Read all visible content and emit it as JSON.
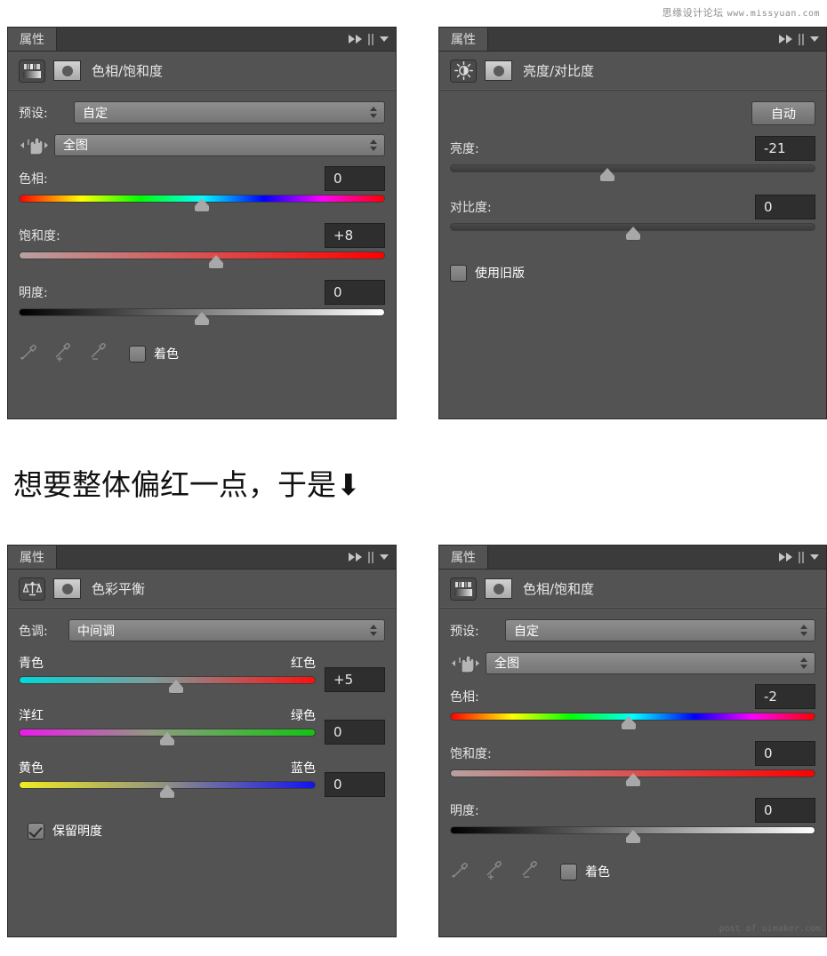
{
  "watermarks": {
    "top_cn": "思缘设计论坛",
    "top_url": "www.missyuan.com",
    "bottom": "post of uimaker.com"
  },
  "caption": "想要整体偏红一点，于是⬇",
  "common": {
    "tab_label": "属性",
    "collapse_icon": "double-right-arrow-icon",
    "grip_icon": "panel-grip-icon",
    "menu_icon": "panel-menu-chevron-icon"
  },
  "panels": [
    {
      "id": "hue-saturation-top",
      "tab": "属性",
      "title": "色相/饱和度",
      "icon": "hue-saturation-gradient-icon",
      "preset_label": "预设:",
      "preset_value": "自定",
      "range_value": "全图",
      "sliders": [
        {
          "label": "色相:",
          "value": "0",
          "pos": 50,
          "track": "g-hue"
        },
        {
          "label": "饱和度:",
          "value": "+8",
          "pos": 54,
          "track": "g-sat"
        },
        {
          "label": "明度:",
          "value": "0",
          "pos": 50,
          "track": "g-light"
        }
      ],
      "colorize_label": "着色",
      "colorize_checked": false,
      "eyedroppers": [
        "eyedropper-icon",
        "eyedropper-add-icon",
        "eyedropper-subtract-icon"
      ]
    },
    {
      "id": "brightness-contrast",
      "tab": "属性",
      "title": "亮度/对比度",
      "icon": "brightness-sun-icon",
      "auto_label": "自动",
      "sliders": [
        {
          "label": "亮度:",
          "value": "-21",
          "pos": 43,
          "track": "g-plain"
        },
        {
          "label": "对比度:",
          "value": "0",
          "pos": 50,
          "track": "g-plain"
        }
      ],
      "legacy_label": "使用旧版",
      "legacy_checked": false
    },
    {
      "id": "color-balance",
      "tab": "属性",
      "title": "色彩平衡",
      "icon": "color-balance-scale-icon",
      "tone_label": "色调:",
      "tone_value": "中间调",
      "sliders": [
        {
          "left": "青色",
          "right": "红色",
          "value": "+5",
          "pos": 53,
          "track": "g-cr"
        },
        {
          "left": "洋红",
          "right": "绿色",
          "value": "0",
          "pos": 50,
          "track": "g-mg"
        },
        {
          "left": "黄色",
          "right": "蓝色",
          "value": "0",
          "pos": 50,
          "track": "g-yb"
        }
      ],
      "preserve_label": "保留明度",
      "preserve_checked": true
    },
    {
      "id": "hue-saturation-bottom",
      "tab": "属性",
      "title": "色相/饱和度",
      "icon": "hue-saturation-gradient-icon",
      "preset_label": "预设:",
      "preset_value": "自定",
      "range_value": "全图",
      "sliders": [
        {
          "label": "色相:",
          "value": "-2",
          "pos": 49,
          "track": "g-hue"
        },
        {
          "label": "饱和度:",
          "value": "0",
          "pos": 50,
          "track": "g-sat"
        },
        {
          "label": "明度:",
          "value": "0",
          "pos": 50,
          "track": "g-light"
        }
      ],
      "colorize_label": "着色",
      "colorize_checked": false,
      "eyedroppers": [
        "eyedropper-icon",
        "eyedropper-add-icon",
        "eyedropper-subtract-icon"
      ]
    }
  ],
  "colors": {
    "panel_bg": "#535353",
    "tabbar_bg": "#3b3b3b",
    "value_bg": "#2e2e2e",
    "text": "#e9e9e9"
  }
}
